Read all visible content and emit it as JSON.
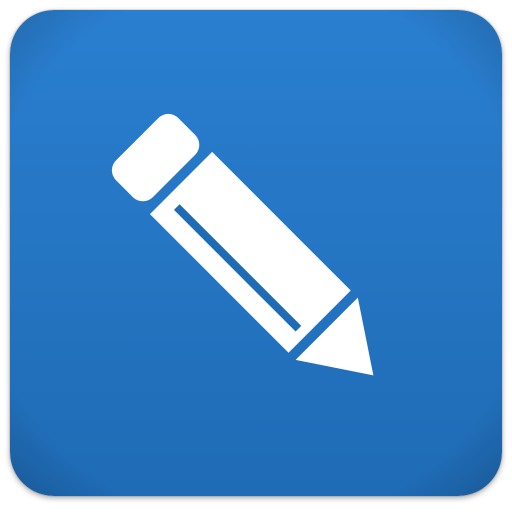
{
  "icon": {
    "name": "pencil-icon",
    "background_color": "#1f6bb5",
    "background_highlight": "#2a7fd0",
    "glyph_color": "#ffffff"
  }
}
